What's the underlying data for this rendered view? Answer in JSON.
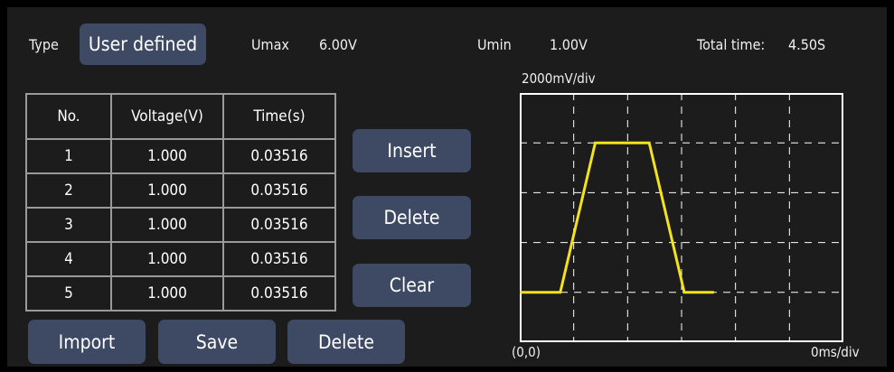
{
  "header": {
    "type_label": "Type",
    "type_value": "User defined",
    "umax_label": "Umax",
    "umax_value": "6.00V",
    "umin_label": "Umin",
    "umin_value": "1.00V",
    "total_time_label": "Total time:",
    "total_time_value": "4.50S"
  },
  "table": {
    "columns": [
      "No.",
      "Voltage(V)",
      "Time(s)"
    ],
    "rows": [
      [
        "1",
        "1.000",
        "0.03516"
      ],
      [
        "2",
        "1.000",
        "0.03516"
      ],
      [
        "3",
        "1.000",
        "0.03516"
      ],
      [
        "4",
        "1.000",
        "0.03516"
      ],
      [
        "5",
        "1.000",
        "0.03516"
      ]
    ]
  },
  "side_buttons": {
    "insert": "Insert",
    "delete": "Delete",
    "clear": "Clear"
  },
  "bottom_buttons": {
    "import": "Import",
    "save": "Save",
    "delete": "Delete"
  },
  "chart": {
    "y_scale_label": "2000mV/div",
    "origin_label": "(0,0)",
    "x_scale_label": "0ms/div",
    "trace_color": "#f3e21c",
    "grid_color": "#ffffff",
    "trace": [
      [
        0,
        1
      ],
      [
        0.75,
        1
      ],
      [
        1.4,
        4
      ],
      [
        2.4,
        4
      ],
      [
        3.05,
        1
      ],
      [
        3.6,
        1
      ]
    ]
  }
}
